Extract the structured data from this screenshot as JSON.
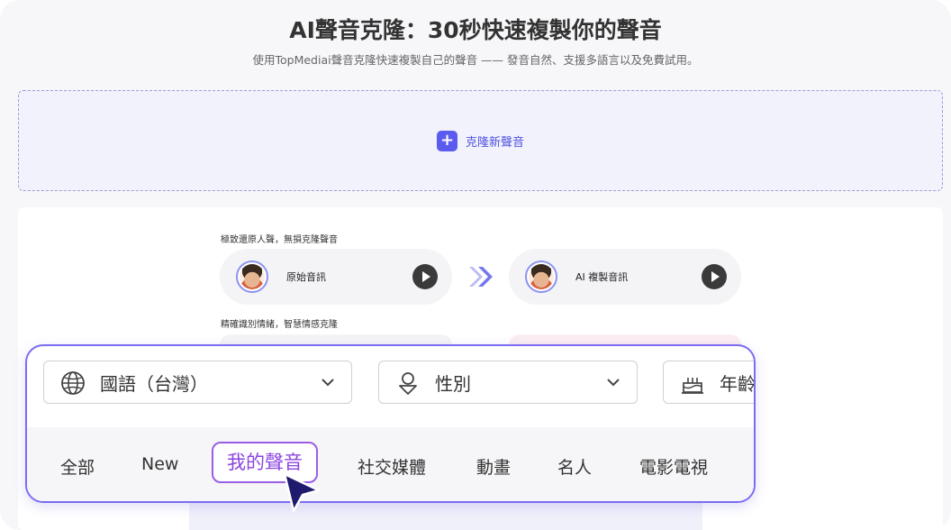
{
  "header": {
    "title": "AI聲音克隆：30秒快速複製你的聲音",
    "subtitle": "使用TopMediai聲音克隆快速複製自己的聲音 —— 發音自然、支援多語言以及免費試用。"
  },
  "clone": {
    "button_label": "克隆新聲音"
  },
  "demo": {
    "caption_1": "極致還原人聲，無損克隆聲音",
    "caption_2": "精確識別情緒，智慧情感克隆",
    "original_label": "原始音訊",
    "ai_label": "AI 複製音訊"
  },
  "filters": {
    "language_value": "國語（台灣）",
    "gender_value": "性別",
    "age_value": "年齡"
  },
  "tabs": [
    "全部",
    "New",
    "我的聲音",
    "社交媒體",
    "動畫",
    "名人",
    "電影電視"
  ],
  "active_tab": "我的聲音",
  "colors": {
    "accent": "#5b5bf0",
    "active_tab": "#9a5ee6",
    "card_border": "#7b6cf2"
  }
}
